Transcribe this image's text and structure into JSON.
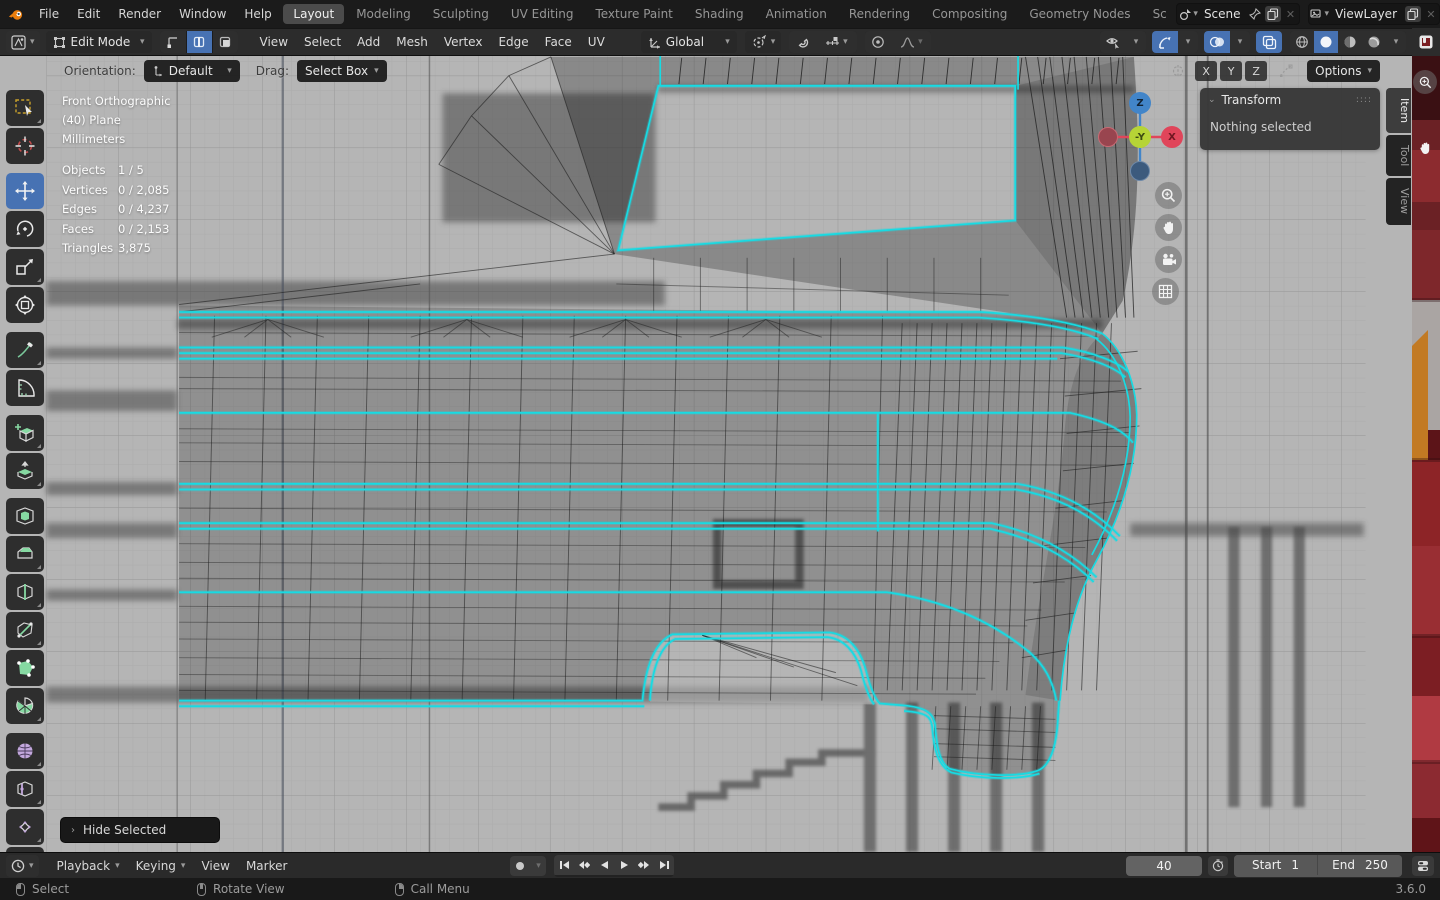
{
  "topbar": {
    "menus": [
      "File",
      "Edit",
      "Render",
      "Window",
      "Help"
    ],
    "workspaces": [
      "Layout",
      "Modeling",
      "Sculpting",
      "UV Editing",
      "Texture Paint",
      "Shading",
      "Animation",
      "Rendering",
      "Compositing",
      "Geometry Nodes",
      "Scripting"
    ],
    "scene": "Scene",
    "view_layer": "ViewLayer"
  },
  "header": {
    "mode": "Edit Mode",
    "menus": [
      "View",
      "Select",
      "Add",
      "Mesh",
      "Vertex",
      "Edge",
      "Face",
      "UV"
    ],
    "orientation": "Global"
  },
  "tool_settings": {
    "orientation_label": "Orientation:",
    "orientation_value": "Default",
    "drag_label": "Drag:",
    "drag_value": "Select Box",
    "axis_x": "X",
    "axis_y": "Y",
    "axis_z": "Z",
    "options_label": "Options"
  },
  "viewport": {
    "view_label": "Front Orthographic",
    "object_label": "(40) Plane",
    "unit_label": "Millimeters",
    "stats": [
      {
        "label": "Objects",
        "value": "1 / 5"
      },
      {
        "label": "Vertices",
        "value": "0 / 2,085"
      },
      {
        "label": "Edges",
        "value": "0 / 4,237"
      },
      {
        "label": "Faces",
        "value": "0 / 2,153"
      },
      {
        "label": "Triangles",
        "value": "3,875"
      }
    ],
    "gizmo": {
      "z": "Z",
      "y_neg": "-Y",
      "x": "X"
    },
    "hide_selected_label": "Hide Selected"
  },
  "sidebar": {
    "panel_title": "Transform",
    "panel_body": "Nothing selected",
    "tabs": [
      "Item",
      "Tool",
      "View"
    ]
  },
  "timeline": {
    "menus": [
      "Playback",
      "Keying",
      "View",
      "Marker"
    ],
    "current_frame": "40",
    "start_label": "Start",
    "start_value": "1",
    "end_label": "End",
    "end_value": "250"
  },
  "statusbar": {
    "items": [
      "Select",
      "Rotate View",
      "Call Menu"
    ],
    "version": "3.6.0"
  },
  "colors": {
    "accent": "#4772b3",
    "selection": "#17dbe3",
    "axis_x": "#e0455a",
    "axis_y": "#b6d436",
    "axis_z": "#4285c9"
  }
}
